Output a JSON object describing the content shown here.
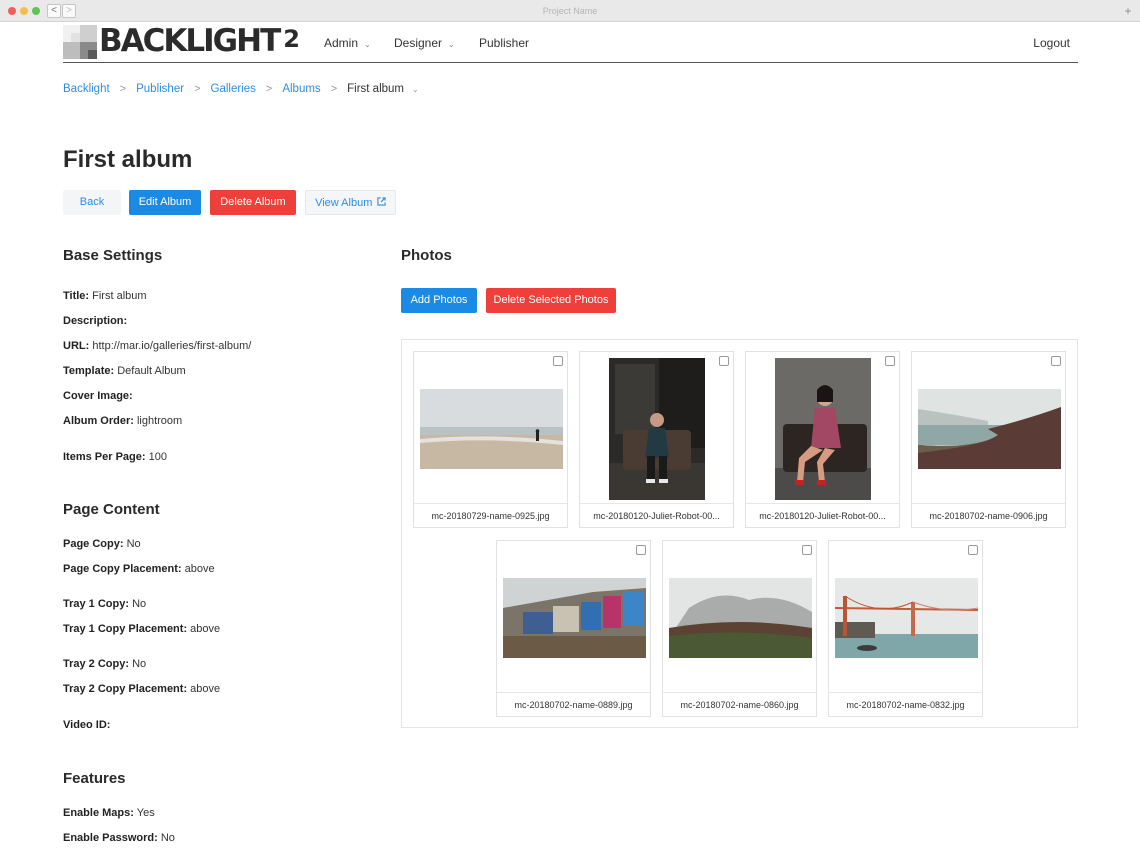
{
  "browser": {
    "title": "Project Name",
    "back": "<",
    "forward": ">",
    "new_tab": "+"
  },
  "nav": {
    "logo_text": "BACKLIGHT",
    "logo_version": "2",
    "items": [
      {
        "label": "Admin",
        "chevron": "⌄"
      },
      {
        "label": "Designer",
        "chevron": "⌄"
      },
      {
        "label": "Publisher"
      }
    ],
    "logout": "Logout"
  },
  "breadcrumb": {
    "items": [
      "Backlight",
      "Publisher",
      "Galleries",
      "Albums"
    ],
    "current": "First album",
    "separator": ">",
    "chevron": "⌄"
  },
  "page": {
    "title": "First album",
    "buttons": {
      "back": "Back",
      "edit": "Edit Album",
      "delete": "Delete Album",
      "view": "View Album",
      "view_icon": "external-link-icon"
    }
  },
  "base_settings": {
    "heading": "Base Settings",
    "fields": [
      {
        "label": "Title:",
        "value": "First album"
      },
      {
        "label": "Description:",
        "value": ""
      },
      {
        "label": "URL:",
        "value": "http://mar.io/galleries/first-album/"
      },
      {
        "label": "Template:",
        "value": "Default Album"
      },
      {
        "label": "Cover Image:",
        "value": ""
      },
      {
        "label": "Album Order:",
        "value": "lightroom"
      },
      {
        "label": "Items Per Page:",
        "value": "100"
      }
    ]
  },
  "page_content": {
    "heading": "Page Content",
    "fields": [
      {
        "label": "Page Copy:",
        "value": "No"
      },
      {
        "label": "Page Copy Placement:",
        "value": "above"
      },
      {
        "label": "Tray 1 Copy:",
        "value": "No"
      },
      {
        "label": "Tray 1 Copy Placement:",
        "value": "above"
      },
      {
        "label": "Tray 2 Copy:",
        "value": "No"
      },
      {
        "label": "Tray 2 Copy Placement:",
        "value": "above"
      },
      {
        "label": "Video ID:",
        "value": ""
      }
    ]
  },
  "features": {
    "heading": "Features",
    "fields": [
      {
        "label": "Enable Maps:",
        "value": "Yes"
      },
      {
        "label": "Enable Password:",
        "value": "No"
      }
    ]
  },
  "photos": {
    "heading": "Photos",
    "add_button": "Add Photos",
    "delete_selected_button": "Delete Selected Photos",
    "items": [
      {
        "filename": "mc-20180729-name-0925.jpg",
        "checked": false
      },
      {
        "filename": "mc-20180120-Juliet-Robot-00...",
        "checked": false
      },
      {
        "filename": "mc-20180120-Juliet-Robot-00...",
        "checked": false
      },
      {
        "filename": "mc-20180702-name-0906.jpg",
        "checked": false
      },
      {
        "filename": "mc-20180702-name-0889.jpg",
        "checked": false
      },
      {
        "filename": "mc-20180702-name-0860.jpg",
        "checked": false
      },
      {
        "filename": "mc-20180702-name-0832.jpg",
        "checked": false
      }
    ]
  },
  "colors": {
    "primary": "#1a8ae5",
    "danger": "#ee3f3a",
    "link": "#2e8ce6"
  }
}
